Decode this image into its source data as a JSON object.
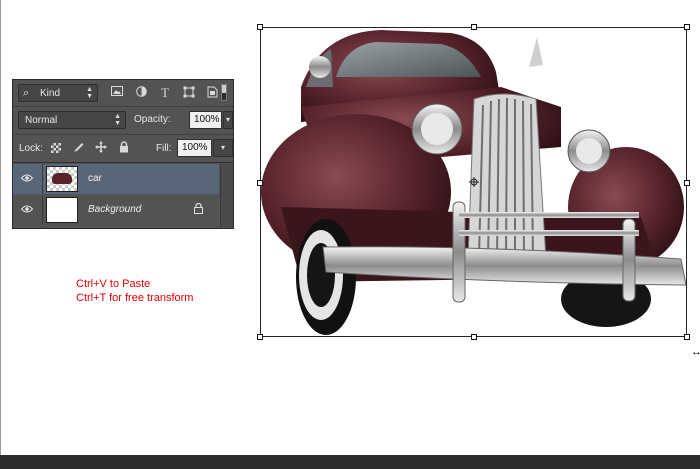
{
  "layers_panel": {
    "filter": {
      "kind_label": "Kind",
      "icons": [
        "pixel-filter-icon",
        "adjustment-filter-icon",
        "type-filter-icon",
        "shape-filter-icon",
        "smart-object-filter-icon"
      ]
    },
    "blend_mode": "Normal",
    "opacity_label": "Opacity:",
    "opacity_value": "100%",
    "lock_label": "Lock:",
    "fill_label": "Fill:",
    "fill_value": "100%",
    "layers": [
      {
        "name": "car",
        "selected": true,
        "visible": true
      },
      {
        "name": "Background",
        "selected": false,
        "visible": true,
        "locked": true
      }
    ]
  },
  "instructions": {
    "line1": "Ctrl+V to Paste",
    "line2": "Ctrl+T for free transform"
  },
  "colors": {
    "panel_bg": "#535353",
    "selected_layer": "#596678",
    "instruction_text": "#e00000",
    "car_body": "#5a2228"
  }
}
